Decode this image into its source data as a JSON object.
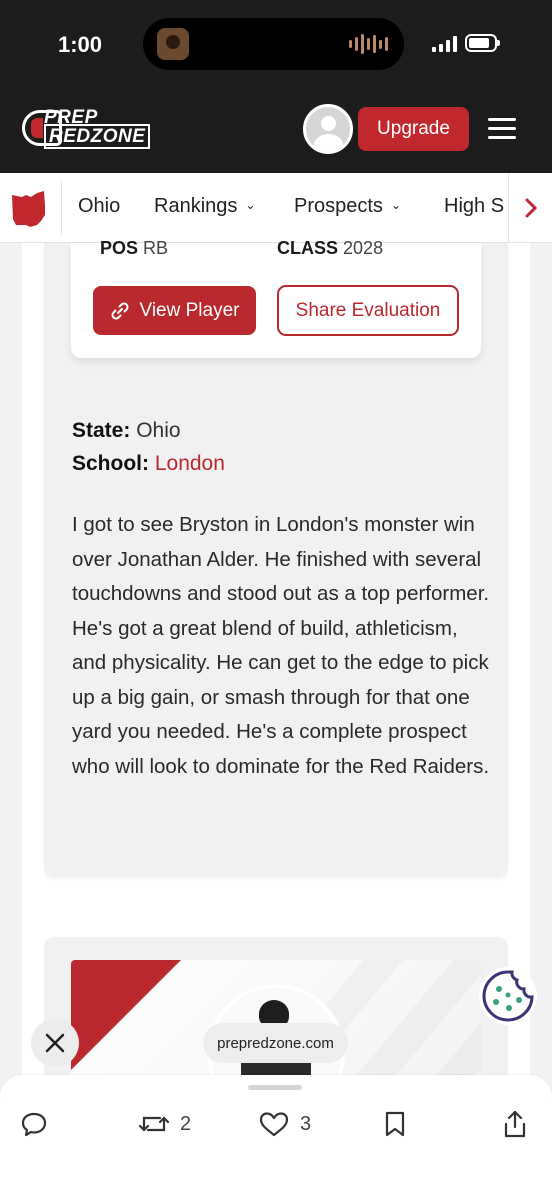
{
  "status_bar": {
    "time": "1:00"
  },
  "header": {
    "logo_line1": "PREP",
    "logo_line2": "REDZONE",
    "upgrade_label": "Upgrade"
  },
  "subnav": {
    "items": [
      {
        "label": "Ohio"
      },
      {
        "label": "Rankings"
      },
      {
        "label": "Prospects"
      },
      {
        "label": "High S"
      }
    ]
  },
  "player_card": {
    "pos_label": "POS",
    "pos_value": "RB",
    "class_label": "CLASS",
    "class_value": "2028",
    "view_player_label": "View Player",
    "share_label": "Share Evaluation"
  },
  "evaluation": {
    "state_label": "State:",
    "state_value": "Ohio",
    "school_label": "School:",
    "school_value": "London",
    "text": "I got to see Bryston in London's monster win over Jonathan Alder. He finished with several touchdowns and stood out as a top performer. He's got a great blend of build, athleticism, and physicality. He can get to the edge to pick up a big gain, or smash through for that one yard you needed. He's a complete prospect who will look to dominate for the Red Raiders."
  },
  "browser": {
    "url": "prepredzone.com"
  },
  "toolbar": {
    "repost_count": "2",
    "like_count": "3"
  },
  "colors": {
    "brand_red": "#b9282d",
    "header_dark": "#1c1c1c"
  },
  "icons": [
    "ohio-state-icon",
    "chevron-down-icon",
    "chevron-right-icon",
    "link-icon",
    "cookie-icon",
    "close-icon",
    "reply-icon",
    "repost-icon",
    "heart-icon",
    "bookmark-icon",
    "share-icon",
    "menu-icon"
  ]
}
